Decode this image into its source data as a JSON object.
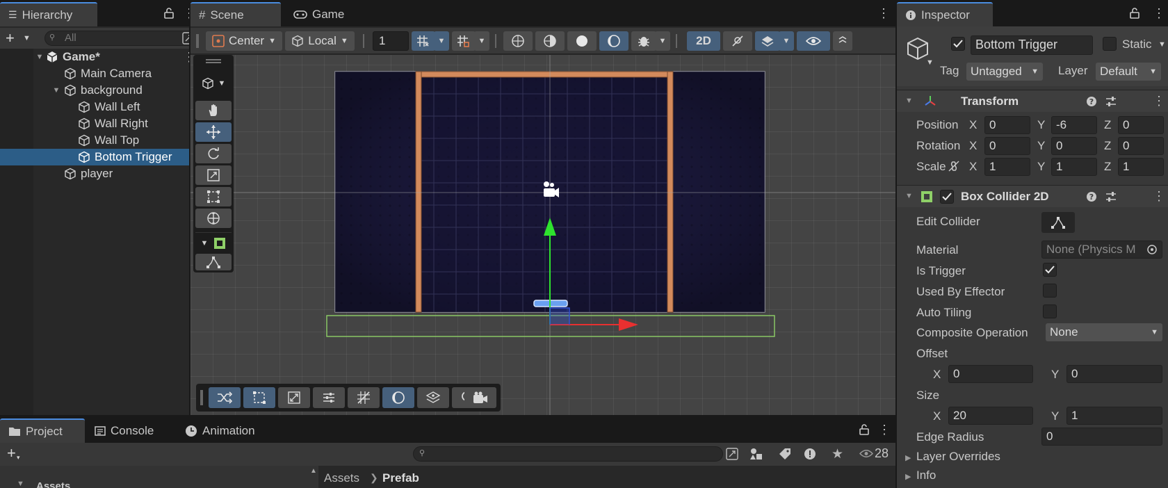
{
  "hierarchy": {
    "tab_label": "Hierarchy",
    "search_placeholder": "All",
    "root": "Game*",
    "items": [
      {
        "label": "Main Camera"
      },
      {
        "label": "background"
      },
      {
        "label": "Wall Left"
      },
      {
        "label": "Wall Right"
      },
      {
        "label": "Wall Top"
      },
      {
        "label": "Bottom Trigger"
      },
      {
        "label": "player"
      }
    ]
  },
  "scene": {
    "tabs": [
      {
        "label": "Scene"
      },
      {
        "label": "Game"
      }
    ],
    "toolbar": {
      "pivot": "Center",
      "space": "Local",
      "grid_size": "1",
      "mode_2d": "2D"
    }
  },
  "inspector": {
    "tab_label": "Inspector",
    "object_name": "Bottom Trigger",
    "static_label": "Static",
    "tag_label": "Tag",
    "tag_value": "Untagged",
    "layer_label": "Layer",
    "layer_value": "Default",
    "transform": {
      "title": "Transform",
      "position_label": "Position",
      "rotation_label": "Rotation",
      "scale_label": "Scale",
      "axis_x": "X",
      "axis_y": "Y",
      "axis_z": "Z",
      "position": {
        "x": "0",
        "y": "-6",
        "z": "0"
      },
      "rotation": {
        "x": "0",
        "y": "0",
        "z": "0"
      },
      "scale": {
        "x": "1",
        "y": "1",
        "z": "1"
      }
    },
    "box_collider": {
      "title": "Box Collider 2D",
      "edit_collider_label": "Edit Collider",
      "material_label": "Material",
      "material_value": "None (Physics M",
      "is_trigger_label": "Is Trigger",
      "is_trigger": true,
      "used_by_effector_label": "Used By Effector",
      "auto_tiling_label": "Auto Tiling",
      "composite_label": "Composite Operation",
      "composite_value": "None",
      "offset_label": "Offset",
      "offset": {
        "x": "0",
        "y": "0"
      },
      "size_label": "Size",
      "size": {
        "x": "20",
        "y": "1"
      },
      "edge_radius_label": "Edge Radius",
      "edge_radius": "0",
      "layer_overrides_label": "Layer Overrides",
      "info_label": "Info"
    }
  },
  "project": {
    "tabs": [
      {
        "label": "Project"
      },
      {
        "label": "Console"
      },
      {
        "label": "Animation"
      }
    ],
    "visible_count": "28",
    "breadcrumb_root": "Assets",
    "breadcrumb_current": "Prefab",
    "tree_item": "Assets"
  },
  "colors": {
    "selection": "#2c5d87",
    "accent": "#4a8ce0",
    "active_tool": "#46607c",
    "collider": "#8fd068",
    "wall": "#d38a5c",
    "scene_bg": "#1a1838"
  }
}
